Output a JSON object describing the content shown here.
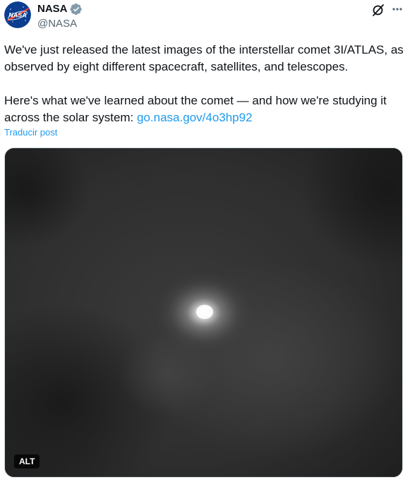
{
  "author": {
    "display_name": "NASA",
    "handle": "@NASA",
    "avatar_text": "NASA"
  },
  "post": {
    "paragraph1": "We've just released the latest images of the interstellar comet 3I/ATLAS, as observed by eight different spacecraft, satellites, and telescopes.",
    "paragraph2_prefix": "Here's what we've learned about the comet — and how we're studying it across the solar system: ",
    "link_text": "go.nasa.gov/4o3hp92",
    "translate_label": "Traducir post"
  },
  "media": {
    "alt_label": "ALT"
  },
  "colors": {
    "link": "#1d9bf0",
    "verified": "#829aab",
    "avatar_bg": "#0b3d91",
    "avatar_red": "#fc3d21"
  },
  "icons": {
    "verified": "verified-badge-icon",
    "grok": "grok-icon",
    "more": "more-options-icon"
  }
}
